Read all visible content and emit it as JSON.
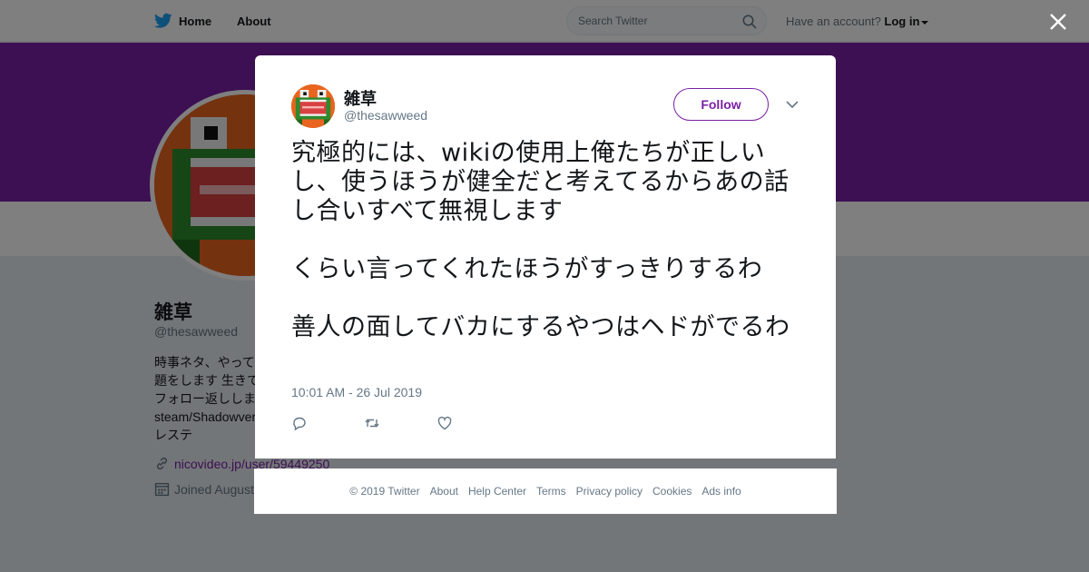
{
  "nav": {
    "home": "Home",
    "about": "About",
    "search_placeholder": "Search Twitter",
    "account_prompt": "Have an account?",
    "login": "Log in"
  },
  "profile": {
    "name": "雑草",
    "handle": "@thesawweed",
    "bio": "時事ネタ、やって\n題をします 生きて\nフォロー返ししま\nsteam/Shadowver\nレステ",
    "link": "nicovideo.jp/user/59449250",
    "joined": "Joined August"
  },
  "tweet": {
    "author_name": "雑草",
    "author_handle": "@thesawweed",
    "follow_label": "Follow",
    "text": "究極的には、wikiの使用上俺たちが正しいし、使うほうが健全だと考えてるからあの話し合いすべて無視します\n\nくらい言ってくれたほうがすっきりするわ\n\n善人の面してバカにするやつはヘドがでるわ",
    "timestamp": "10:01 AM - 26 Jul 2019",
    "actions": [
      "reply-icon",
      "retweet-icon",
      "like-icon"
    ]
  },
  "footer": {
    "links": [
      "© 2019 Twitter",
      "About",
      "Help Center",
      "Terms",
      "Privacy policy",
      "Cookies",
      "Ads info"
    ]
  },
  "colors": {
    "brand": "#7a1fa6",
    "twitter_blue": "#1da1f2",
    "overlay": "rgba(0,0,0,0.5)"
  }
}
